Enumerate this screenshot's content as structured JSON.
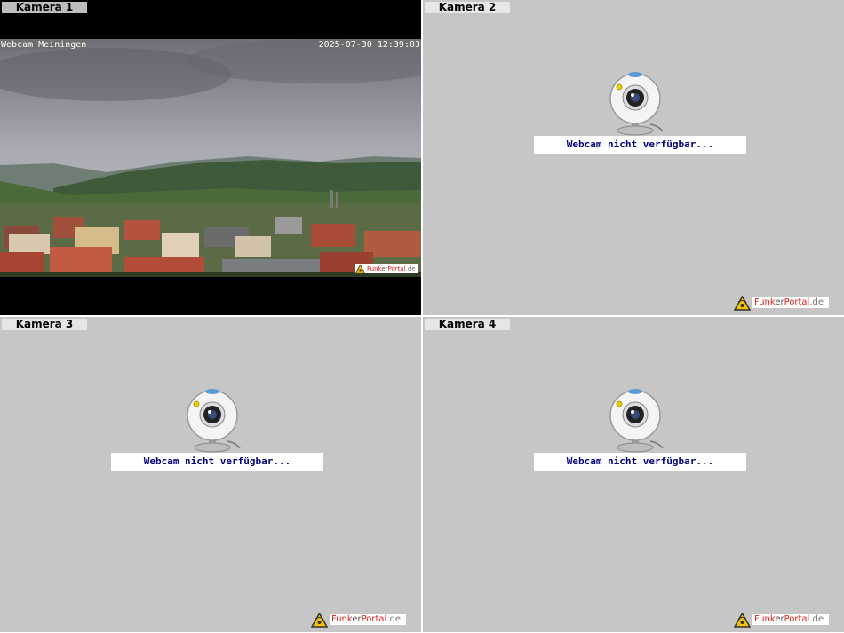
{
  "cameras": [
    {
      "label": "Kamera 1",
      "overlay_left": "Webcam Meiningen",
      "overlay_right": "2025-07-30 12:39:03"
    },
    {
      "label": "Kamera 2",
      "message": "Webcam nicht verfügbar..."
    },
    {
      "label": "Kamera 3",
      "message": "Webcam nicht verfügbar..."
    },
    {
      "label": "Kamera 4",
      "message": "Webcam nicht verfügbar..."
    }
  ],
  "brand": {
    "part1": "Funk",
    "part2": "er",
    "part3": "Portal",
    "part4": ".de"
  },
  "icons": {
    "camera": "webcam-icon",
    "logo": "funkerportal-logo-icon"
  },
  "colors": {
    "cell_bg": "#c6c6c6",
    "message_text": "#000080",
    "brand_red": "#e2231a"
  }
}
